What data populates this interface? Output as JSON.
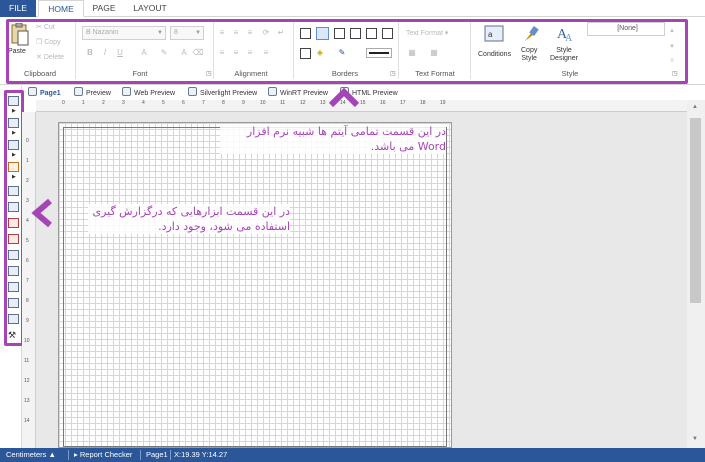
{
  "menu": {
    "file": "FILE",
    "home": "HOME",
    "page": "PAGE",
    "layout": "LAYOUT"
  },
  "ribbon": {
    "clipboard": {
      "label": "Clipboard",
      "paste": "Paste",
      "cut": "Cut",
      "copy": "Copy",
      "delete": "Delete"
    },
    "font": {
      "label": "Font",
      "family": "B Nazanin",
      "size": "8",
      "bold": "B",
      "italic": "I",
      "underline": "U"
    },
    "alignment": {
      "label": "Alignment"
    },
    "borders": {
      "label": "Borders"
    },
    "text_format": {
      "label": "Text Format",
      "value": "Text Format"
    },
    "style": {
      "label": "Style",
      "conditions": "Conditions",
      "copy_style": "Copy\nStyle",
      "style_designer": "Style\nDesigner",
      "style_value": "[None]"
    }
  },
  "preview_tabs": [
    "Page1",
    "Preview",
    "Web Preview",
    "Silverlight Preview",
    "WinRT Preview",
    "HTML Preview"
  ],
  "ruler": {
    "top": [
      "0",
      "1",
      "2",
      "3",
      "4",
      "5",
      "6",
      "7",
      "8",
      "9",
      "10",
      "11",
      "12",
      "13",
      "14",
      "15",
      "16",
      "17",
      "18",
      "19"
    ],
    "left": [
      "0",
      "1",
      "2",
      "3",
      "4",
      "5",
      "6",
      "7",
      "8",
      "9",
      "10",
      "11",
      "12",
      "13",
      "14"
    ]
  },
  "annotations": {
    "top": "در این قسمت تمامی آیتم ها شبیه نرم افزار Word می باشد.",
    "left": "در این قسمت ابزارهایی که درگزارش گیری استفاده می شود، وجود دارد."
  },
  "statusbar": {
    "units": "Centimeters",
    "checker": "Report Checker",
    "page": "Page1",
    "coords": "X:19.39  Y:14.27"
  },
  "colors": {
    "accent": "#2b579a",
    "highlight": "#a545b5"
  }
}
